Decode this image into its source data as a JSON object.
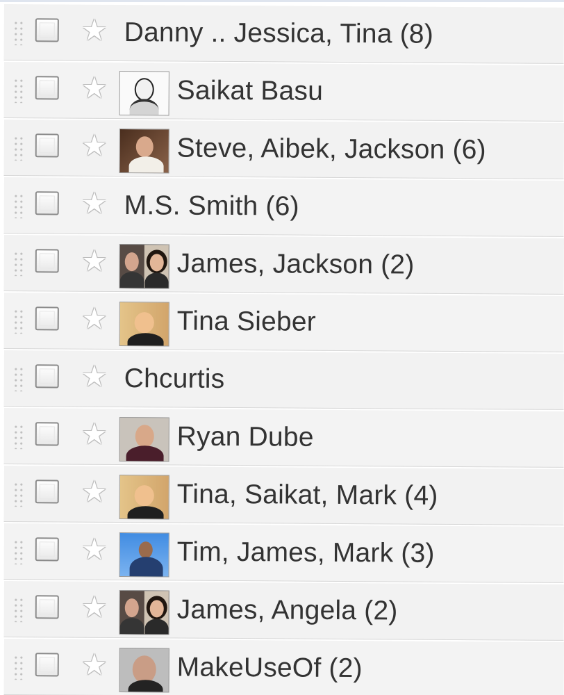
{
  "conversations": [
    {
      "participants": "Danny .. Jessica, Tina (8)",
      "avatar": "none"
    },
    {
      "participants": "Saikat Basu",
      "avatar": "bw-portrait"
    },
    {
      "participants": "Steve, Aibek, Jackson (6)",
      "avatar": "brown-portrait"
    },
    {
      "participants": "M.S. Smith (6)",
      "avatar": "none"
    },
    {
      "participants": "James, Jackson (2)",
      "avatar": "pair-portrait"
    },
    {
      "participants": "Tina Sieber",
      "avatar": "warm-portrait"
    },
    {
      "participants": "Chcurtis",
      "avatar": "none"
    },
    {
      "participants": "Ryan Dube",
      "avatar": "dark-portrait"
    },
    {
      "participants": "Tina, Saikat, Mark (4)",
      "avatar": "warm-portrait"
    },
    {
      "participants": "Tim, James, Mark (3)",
      "avatar": "blue-portrait"
    },
    {
      "participants": "James, Angela (2)",
      "avatar": "pair-portrait"
    },
    {
      "participants": "MakeUseOf (2)",
      "avatar": "muo-portrait"
    }
  ],
  "icons": {
    "drag": "drag-handle-icon",
    "checkbox": "checkbox-icon",
    "star": "star-icon"
  },
  "colors": {
    "row_background": "#f3f3f3",
    "row_border": "#d7d7d7",
    "text": "#333333",
    "top_rule": "#dfe5ef"
  }
}
